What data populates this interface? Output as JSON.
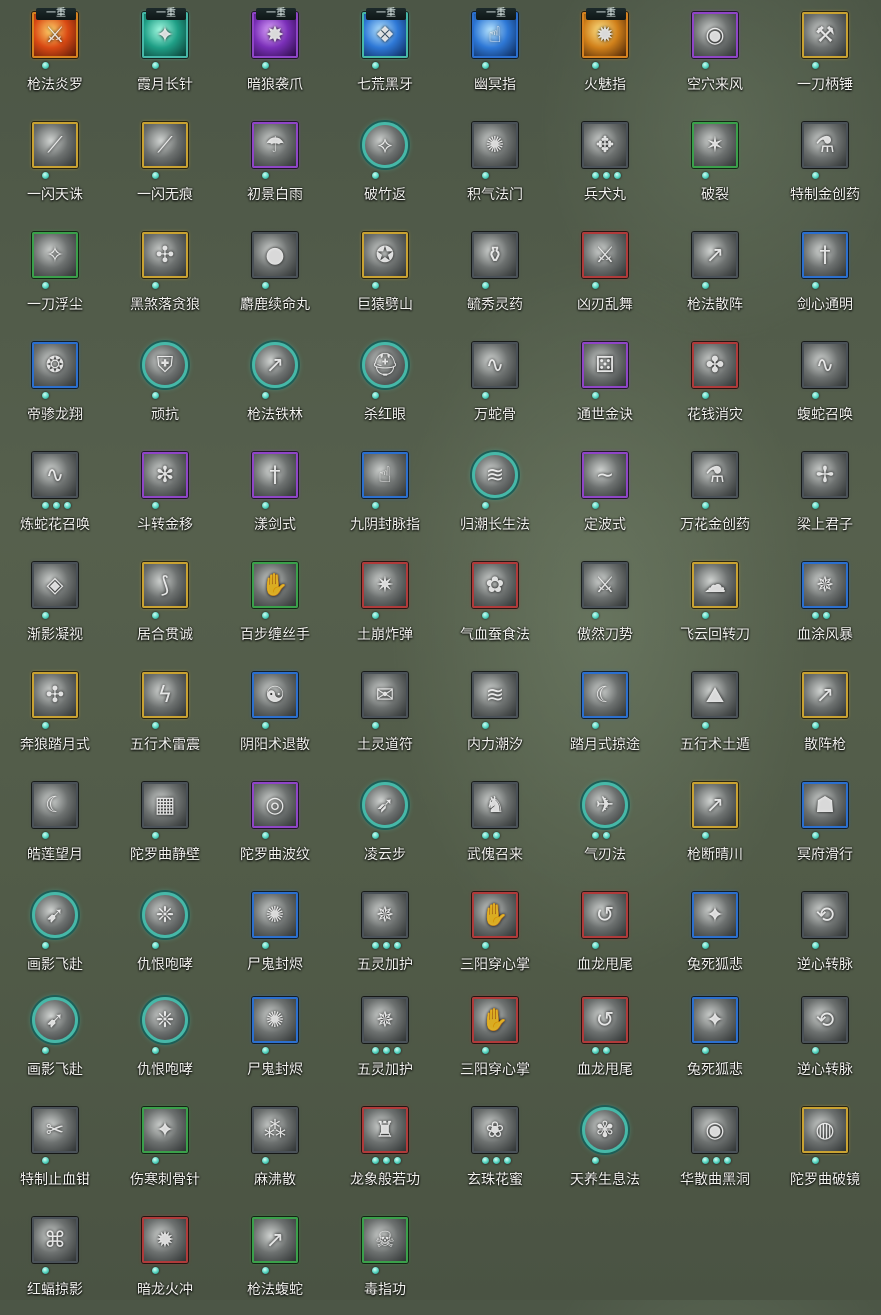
{
  "border_colors": {
    "grey": "#4a5158",
    "gold": "#c9a232",
    "purple": "#8f45c8",
    "blue": "#2b6fcf",
    "green": "#3aa04a",
    "red": "#b03a3a",
    "teal": "#46b8a8",
    "orange": "#d7821f"
  },
  "icon_bg": {
    "orange": [
      "#ffd36a",
      "#d94a14",
      "#5a1808"
    ],
    "teal": [
      "#a8ffe6",
      "#1f9f86",
      "#0b3a33"
    ],
    "violet": [
      "#e0a8ff",
      "#7a2fb8",
      "#2a0c45"
    ],
    "blue": [
      "#b9e6ff",
      "#2e78d6",
      "#0c2858"
    ],
    "gold": [
      "#ffe58a",
      "#d0801a",
      "#4a2408"
    ],
    "grey": [
      "#cfd2d0",
      "#6d7170",
      "#2f3333"
    ]
  },
  "skills": [
    {
      "name": "枪法炎罗",
      "border": "orange",
      "bg": "orange",
      "badge": "一重",
      "dots": 1,
      "glyph": "sword-fire-icon"
    },
    {
      "name": "霞月长针",
      "border": "teal",
      "bg": "teal",
      "badge": "一重",
      "dots": 1,
      "glyph": "needle-icon"
    },
    {
      "name": "暗狼袭爪",
      "border": "purple",
      "bg": "violet",
      "badge": "一重",
      "dots": 1,
      "glyph": "claw-icon"
    },
    {
      "name": "七荒黑牙",
      "border": "teal",
      "bg": "blue",
      "badge": "一重",
      "dots": 1,
      "glyph": "fang-icon",
      "special": true
    },
    {
      "name": "幽冥指",
      "border": "blue",
      "bg": "blue",
      "badge": "一重",
      "dots": 1,
      "glyph": "finger-icon",
      "special": true
    },
    {
      "name": "火魅指",
      "border": "orange",
      "bg": "gold",
      "badge": "一重",
      "dots": 1,
      "glyph": "flame-finger-icon"
    },
    {
      "name": "空穴来风",
      "border": "purple",
      "bg": "grey",
      "dots": 1,
      "glyph": "coin-icon"
    },
    {
      "name": "一刀柄锤",
      "border": "gold",
      "bg": "grey",
      "dots": 1,
      "glyph": "hammer-icon"
    },
    {
      "name": "一闪天诛",
      "border": "gold",
      "bg": "grey",
      "dots": 1,
      "glyph": "slash-icon"
    },
    {
      "name": "一闪无痕",
      "border": "gold",
      "bg": "grey",
      "dots": 1,
      "glyph": "slash-icon"
    },
    {
      "name": "初景白雨",
      "border": "purple",
      "bg": "grey",
      "dots": 1,
      "glyph": "rain-icon"
    },
    {
      "name": "破竹返",
      "border": "teal",
      "bg": "grey",
      "dots": 1,
      "glyph": "bamboo-icon",
      "round": true
    },
    {
      "name": "积气法门",
      "border": "grey",
      "bg": "grey",
      "dots": 1,
      "glyph": "qi-icon"
    },
    {
      "name": "兵犬丸",
      "border": "grey",
      "bg": "grey",
      "dots": 3,
      "glyph": "dog-icon"
    },
    {
      "name": "破裂",
      "border": "green",
      "bg": "grey",
      "dots": 1,
      "glyph": "shatter-icon"
    },
    {
      "name": "特制金创药",
      "border": "grey",
      "bg": "grey",
      "dots": 1,
      "glyph": "potion-icon"
    },
    {
      "name": "一刀浮尘",
      "border": "green",
      "bg": "grey",
      "dots": 1,
      "glyph": "dust-icon"
    },
    {
      "name": "黑煞落贪狼",
      "border": "gold",
      "bg": "grey",
      "dots": 1,
      "glyph": "wolf-icon"
    },
    {
      "name": "麝鹿续命丸",
      "border": "grey",
      "bg": "grey",
      "dots": 1,
      "glyph": "pill-icon"
    },
    {
      "name": "巨猿劈山",
      "border": "gold",
      "bg": "grey",
      "dots": 1,
      "glyph": "ape-icon"
    },
    {
      "name": "毓秀灵药",
      "border": "grey",
      "bg": "grey",
      "dots": 1,
      "glyph": "gourd-icon"
    },
    {
      "name": "凶刃乱舞",
      "border": "red",
      "bg": "grey",
      "dots": 1,
      "glyph": "blade-icon"
    },
    {
      "name": "枪法散阵",
      "border": "grey",
      "bg": "grey",
      "dots": 1,
      "glyph": "spear-icon"
    },
    {
      "name": "剑心通明",
      "border": "blue",
      "bg": "grey",
      "dots": 1,
      "glyph": "sword-icon"
    },
    {
      "name": "帝骖龙翔",
      "border": "blue",
      "bg": "grey",
      "dots": 1,
      "glyph": "dragon-icon"
    },
    {
      "name": "顽抗",
      "border": "teal",
      "bg": "grey",
      "dots": 1,
      "glyph": "shield-icon",
      "round": true
    },
    {
      "name": "枪法铁林",
      "border": "teal",
      "bg": "grey",
      "dots": 1,
      "glyph": "spear-icon",
      "round": true
    },
    {
      "name": "杀红眼",
      "border": "teal",
      "bg": "grey",
      "dots": 1,
      "glyph": "helmet-icon",
      "round": true
    },
    {
      "name": "万蛇骨",
      "border": "grey",
      "bg": "grey",
      "dots": 1,
      "glyph": "snake-icon"
    },
    {
      "name": "通世金诀",
      "border": "purple",
      "bg": "grey",
      "dots": 1,
      "glyph": "dice-icon"
    },
    {
      "name": "花钱消灾",
      "border": "red",
      "bg": "grey",
      "dots": 1,
      "glyph": "pouch-icon"
    },
    {
      "name": "蝮蛇召唤",
      "border": "grey",
      "bg": "grey",
      "dots": 1,
      "glyph": "snake-icon"
    },
    {
      "name": "炼蛇花召唤",
      "border": "grey",
      "bg": "grey",
      "dots": 3,
      "glyph": "snake-icon"
    },
    {
      "name": "斗转金移",
      "border": "purple",
      "bg": "grey",
      "dots": 1,
      "glyph": "swirl-icon"
    },
    {
      "name": "漾剑式",
      "border": "purple",
      "bg": "grey",
      "dots": 1,
      "glyph": "sword-icon"
    },
    {
      "name": "九阴封脉指",
      "border": "blue",
      "bg": "grey",
      "dots": 1,
      "glyph": "finger-icon"
    },
    {
      "name": "归潮长生法",
      "border": "teal",
      "bg": "grey",
      "dots": 1,
      "glyph": "tide-icon",
      "round": true
    },
    {
      "name": "定波式",
      "border": "purple",
      "bg": "grey",
      "dots": 1,
      "glyph": "wave-icon"
    },
    {
      "name": "万花金创药",
      "border": "grey",
      "bg": "grey",
      "dots": 1,
      "glyph": "potion-icon"
    },
    {
      "name": "梁上君子",
      "border": "grey",
      "bg": "grey",
      "dots": 1,
      "glyph": "thief-icon"
    },
    {
      "name": "渐影凝视",
      "border": "grey",
      "bg": "grey",
      "dots": 1,
      "glyph": "eye-icon"
    },
    {
      "name": "居合贯诚",
      "border": "gold",
      "bg": "grey",
      "dots": 1,
      "glyph": "iai-icon"
    },
    {
      "name": "百步缠丝手",
      "border": "green",
      "bg": "grey",
      "dots": 1,
      "glyph": "hand-icon"
    },
    {
      "name": "土崩炸弹",
      "border": "red",
      "bg": "grey",
      "dots": 1,
      "glyph": "bomb-icon"
    },
    {
      "name": "气血蚕食法",
      "border": "red",
      "bg": "grey",
      "dots": 1,
      "glyph": "blood-icon"
    },
    {
      "name": "傲然刀势",
      "border": "grey",
      "bg": "grey",
      "dots": 1,
      "glyph": "blade-icon"
    },
    {
      "name": "飞云回转刀",
      "border": "gold",
      "bg": "grey",
      "dots": 1,
      "glyph": "cloud-icon"
    },
    {
      "name": "血涂风暴",
      "border": "blue",
      "bg": "grey",
      "dots": 2,
      "glyph": "storm-icon"
    },
    {
      "name": "奔狼踏月式",
      "border": "gold",
      "bg": "grey",
      "dots": 1,
      "glyph": "wolf-icon"
    },
    {
      "name": "五行术雷震",
      "border": "gold",
      "bg": "grey",
      "dots": 1,
      "glyph": "thunder-icon"
    },
    {
      "name": "阴阳术退散",
      "border": "blue",
      "bg": "grey",
      "dots": 1,
      "glyph": "yinyang-icon"
    },
    {
      "name": "土灵道符",
      "border": "grey",
      "bg": "grey",
      "dots": 1,
      "glyph": "talisman-icon"
    },
    {
      "name": "内力潮汐",
      "border": "grey",
      "bg": "grey",
      "dots": 1,
      "glyph": "tide-icon"
    },
    {
      "name": "踏月式掠途",
      "border": "blue",
      "bg": "grey",
      "dots": 1,
      "glyph": "moon-icon"
    },
    {
      "name": "五行术土遁",
      "border": "grey",
      "bg": "grey",
      "dots": 1,
      "glyph": "earth-icon"
    },
    {
      "name": "散阵枪",
      "border": "gold",
      "bg": "grey",
      "dots": 1,
      "glyph": "spear-icon"
    },
    {
      "name": "皓莲望月",
      "border": "grey",
      "bg": "grey",
      "dots": 1,
      "glyph": "moon-icon"
    },
    {
      "name": "陀罗曲静壁",
      "border": "grey",
      "bg": "grey",
      "dots": 1,
      "glyph": "wall-icon"
    },
    {
      "name": "陀罗曲波纹",
      "border": "purple",
      "bg": "grey",
      "dots": 1,
      "glyph": "ripple-icon"
    },
    {
      "name": "凌云步",
      "border": "teal",
      "bg": "grey",
      "dots": 1,
      "glyph": "step-icon",
      "round": true
    },
    {
      "name": "武傀召来",
      "border": "grey",
      "bg": "grey",
      "dots": 2,
      "glyph": "puppet-icon"
    },
    {
      "name": "气刃法",
      "border": "teal",
      "bg": "grey",
      "dots": 2,
      "glyph": "wind-blade-icon",
      "round": true
    },
    {
      "name": "枪断晴川",
      "border": "gold",
      "bg": "grey",
      "dots": 1,
      "glyph": "spear-icon"
    },
    {
      "name": "冥府滑行",
      "border": "blue",
      "bg": "grey",
      "dots": 1,
      "glyph": "ghost-icon"
    },
    {
      "name": "画影飞赴",
      "border": "teal",
      "bg": "grey",
      "dots": 1,
      "glyph": "shadow-icon",
      "round": true
    },
    {
      "name": "仇恨咆哮",
      "border": "teal",
      "bg": "grey",
      "dots": 1,
      "glyph": "roar-icon",
      "round": true
    },
    {
      "name": "尸鬼封烬",
      "border": "blue",
      "bg": "grey",
      "dots": 1,
      "glyph": "seal-icon"
    },
    {
      "name": "五灵加护",
      "border": "grey",
      "bg": "grey",
      "dots": 3,
      "glyph": "spirit-icon"
    },
    {
      "name": "三阳穿心掌",
      "border": "red",
      "bg": "grey",
      "dots": 1,
      "glyph": "palm-icon"
    },
    {
      "name": "血龙甩尾",
      "border": "red",
      "bg": "grey",
      "dots": 1,
      "glyph": "tail-icon"
    },
    {
      "name": "兔死狐悲",
      "border": "blue",
      "bg": "grey",
      "dots": 1,
      "glyph": "fox-icon"
    },
    {
      "name": "逆心转脉",
      "border": "grey",
      "bg": "grey",
      "dots": 1,
      "glyph": "pulse-icon"
    },
    {
      "name": "画影飞赴",
      "border": "teal",
      "bg": "grey",
      "dots": 1,
      "glyph": "shadow-icon",
      "round": true
    },
    {
      "name": "仇恨咆哮",
      "border": "teal",
      "bg": "grey",
      "dots": 1,
      "glyph": "roar-icon",
      "round": true
    },
    {
      "name": "尸鬼封烬",
      "border": "blue",
      "bg": "grey",
      "dots": 1,
      "glyph": "seal-icon"
    },
    {
      "name": "五灵加护",
      "border": "grey",
      "bg": "grey",
      "dots": 3,
      "glyph": "spirit-icon"
    },
    {
      "name": "三阳穿心掌",
      "border": "red",
      "bg": "grey",
      "dots": 1,
      "glyph": "palm-icon"
    },
    {
      "name": "血龙甩尾",
      "border": "red",
      "bg": "grey",
      "dots": 2,
      "glyph": "tail-icon"
    },
    {
      "name": "兔死狐悲",
      "border": "blue",
      "bg": "grey",
      "dots": 1,
      "glyph": "fox-icon"
    },
    {
      "name": "逆心转脉",
      "border": "grey",
      "bg": "grey",
      "dots": 1,
      "glyph": "pulse-icon"
    },
    {
      "name": "特制止血钳",
      "border": "grey",
      "bg": "grey",
      "dots": 1,
      "glyph": "clamp-icon"
    },
    {
      "name": "伤寒刺骨针",
      "border": "green",
      "bg": "grey",
      "dots": 1,
      "glyph": "needle-icon"
    },
    {
      "name": "麻沸散",
      "border": "grey",
      "bg": "grey",
      "dots": 1,
      "glyph": "powder-icon"
    },
    {
      "name": "龙象般若功",
      "border": "red",
      "bg": "grey",
      "dots": 3,
      "glyph": "elephant-icon"
    },
    {
      "name": "玄珠花蜜",
      "border": "grey",
      "bg": "grey",
      "dots": 3,
      "glyph": "flower-icon"
    },
    {
      "name": "天养生息法",
      "border": "teal",
      "bg": "grey",
      "dots": 1,
      "glyph": "breath-icon",
      "round": true
    },
    {
      "name": "华散曲黑洞",
      "border": "grey",
      "bg": "grey",
      "dots": 3,
      "glyph": "blackhole-icon"
    },
    {
      "name": "陀罗曲破镜",
      "border": "gold",
      "bg": "grey",
      "dots": 1,
      "glyph": "mirror-icon"
    },
    {
      "name": "红蝠掠影",
      "border": "grey",
      "bg": "grey",
      "dots": 1,
      "glyph": "bat-icon"
    },
    {
      "name": "暗龙火冲",
      "border": "red",
      "bg": "grey",
      "dots": 1,
      "glyph": "dragon-fire-icon"
    },
    {
      "name": "枪法蝮蛇",
      "border": "green",
      "bg": "grey",
      "dots": 1,
      "glyph": "spear-icon"
    },
    {
      "name": "毒指功",
      "border": "green",
      "bg": "grey",
      "dots": 1,
      "glyph": "poison-finger-icon"
    }
  ]
}
